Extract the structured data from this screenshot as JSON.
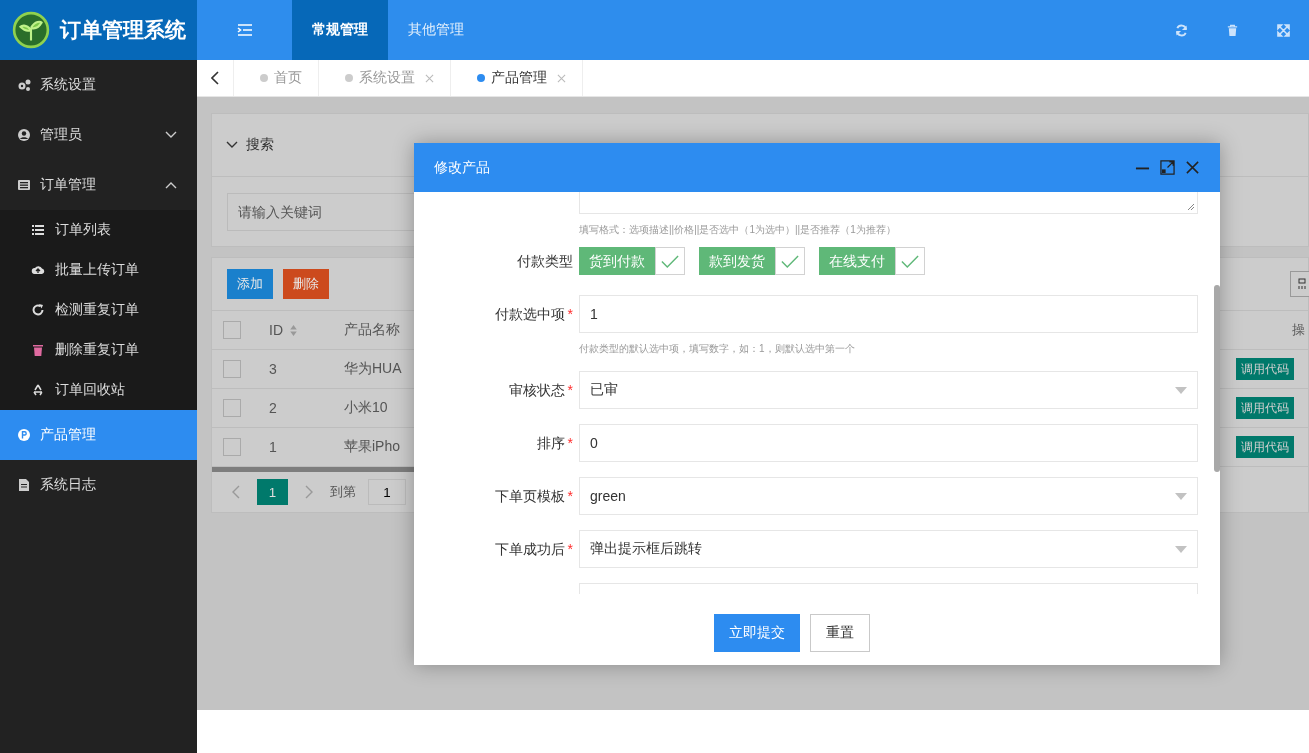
{
  "app_title": "订单管理系统",
  "nav_tabs": [
    {
      "label": "常规管理",
      "selected": true
    },
    {
      "label": "其他管理",
      "selected": false
    }
  ],
  "page_tabs": [
    {
      "label": "首页",
      "selected": false,
      "closable": false
    },
    {
      "label": "系统设置",
      "selected": false,
      "closable": true
    },
    {
      "label": "产品管理",
      "selected": true,
      "closable": true
    }
  ],
  "sidebar": {
    "items": [
      {
        "label": "系统设置",
        "selected": false
      },
      {
        "label": "管理员",
        "selected": false,
        "expanded": false
      },
      {
        "label": "订单管理",
        "selected": false,
        "expanded": true,
        "children": [
          {
            "label": "订单列表",
            "selected": false
          },
          {
            "label": "批量上传订单",
            "selected": false
          },
          {
            "label": "检测重复订单",
            "selected": false
          },
          {
            "label": "删除重复订单",
            "selected": false
          },
          {
            "label": "订单回收站",
            "selected": false
          }
        ]
      },
      {
        "label": "产品管理",
        "selected": true
      },
      {
        "label": "系统日志",
        "selected": false
      }
    ]
  },
  "search_panel": {
    "title": "搜索",
    "placeholder": "请输入关键词"
  },
  "toolbar_buttons": [
    {
      "label": "添加",
      "kind": "primary"
    },
    {
      "label": "删除",
      "kind": "danger"
    }
  ],
  "table": {
    "columns": [
      "ID",
      "产品名称"
    ],
    "column_last": "操",
    "header_checked": false,
    "rows": [
      {
        "id": "3",
        "name": "华为HUA",
        "action": "调用代码",
        "checked": false
      },
      {
        "id": "2",
        "name": "小米10",
        "action": "调用代码",
        "checked": false
      },
      {
        "id": "1",
        "name": "苹果iPho",
        "action": "调用代码",
        "checked": false
      }
    ]
  },
  "pagination": {
    "current": "1",
    "goto_label": "到第",
    "goto_value": "1"
  },
  "modal": {
    "title": "修改产品",
    "fields": [
      {
        "kind": "textarea",
        "hint": "填写格式：选项描述||价格||是否选中（1为选中）||是否推荐（1为推荐）"
      },
      {
        "kind": "checkgroup",
        "label": "付款类型",
        "options": [
          {
            "label": "货到付款",
            "checked": true
          },
          {
            "label": "款到发货",
            "checked": true
          },
          {
            "label": "在线支付",
            "checked": true
          }
        ]
      },
      {
        "kind": "input",
        "label": "付款选中项",
        "required_mark": "*",
        "value": "1",
        "hint": "付款类型的默认选中项，填写数字，如：1，则默认选中第一个"
      },
      {
        "kind": "select",
        "label": "审核状态",
        "required_mark": "*",
        "value": "已审"
      },
      {
        "kind": "input",
        "label": "排序",
        "required_mark": "*",
        "value": "0"
      },
      {
        "kind": "select",
        "label": "下单页模板",
        "required_mark": "*",
        "value": "green"
      },
      {
        "kind": "select",
        "label": "下单成功后",
        "required_mark": "*",
        "value": "弹出提示框后跳转"
      },
      {
        "kind": "partial"
      }
    ],
    "buttons": [
      {
        "label": "立即提交",
        "kind": "primary"
      },
      {
        "label": "重置",
        "kind": "plain"
      }
    ]
  }
}
